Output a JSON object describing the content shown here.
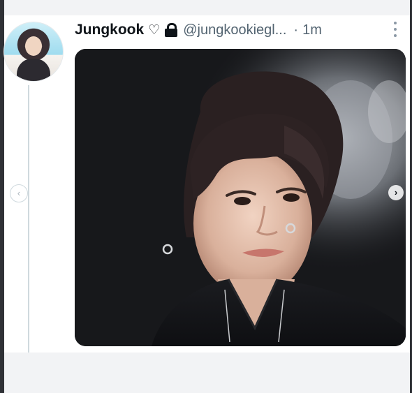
{
  "tweet": {
    "display_name": "Jungkook",
    "name_emoji": "♡",
    "lock_icon": "lock-icon",
    "handle": "@jungkookiegl...",
    "separator": "·",
    "timestamp": "1m",
    "more_icon": "more-vertical-icon"
  },
  "carousel": {
    "prev_glyph": "‹",
    "next_glyph": "›"
  },
  "colors": {
    "text_primary": "#0f1419",
    "text_secondary": "#536471",
    "thread_line": "#cfd9de"
  }
}
